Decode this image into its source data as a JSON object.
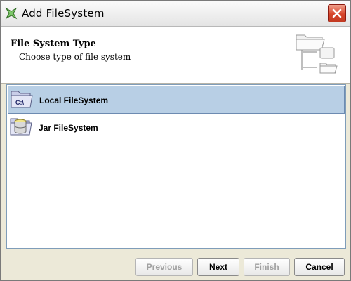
{
  "window": {
    "title": "Add FileSystem",
    "app_icon": "netbeans-star-icon",
    "close_icon": "close-x-icon"
  },
  "header": {
    "title": "File System Type",
    "subtitle": "Choose type of file system",
    "icon": "filesystem-tree-icon"
  },
  "list": {
    "items": [
      {
        "label": "Local FileSystem",
        "icon": "local-folder-icon",
        "icon_text": "C:\\",
        "selected": true
      },
      {
        "label": "Jar FileSystem",
        "icon": "jar-folder-icon",
        "selected": false
      }
    ]
  },
  "buttons": {
    "previous": "Previous",
    "next": "Next",
    "finish": "Finish",
    "cancel": "Cancel"
  },
  "colors": {
    "selection": "#b8cfe5",
    "close_button": "#d7452a",
    "window_bg": "#ece9d8"
  }
}
